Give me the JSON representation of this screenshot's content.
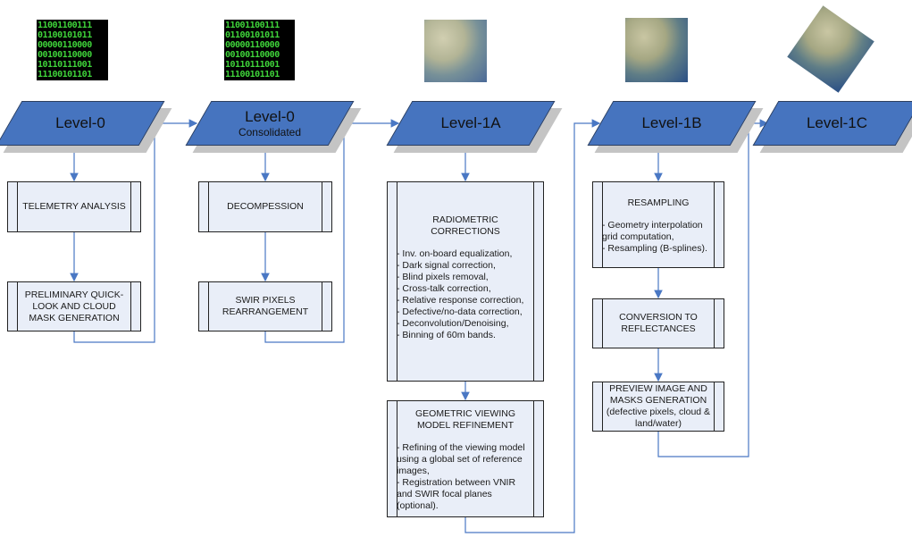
{
  "levels": [
    {
      "title": "Level-0",
      "subtitle": ""
    },
    {
      "title": "Level-0",
      "subtitle": "Consolidated"
    },
    {
      "title": "Level-1A",
      "subtitle": ""
    },
    {
      "title": "Level-1B",
      "subtitle": ""
    },
    {
      "title": "Level-1C",
      "subtitle": ""
    }
  ],
  "binary_rows": [
    "11001100111",
    "01100101011",
    "00000110000",
    "00100110000",
    "10110111001",
    "11100101101"
  ],
  "colors": {
    "level_fill": "#4674bf",
    "box_fill": "#e9eef8",
    "connector": "#4a78c4"
  },
  "boxes": {
    "telemetry": {
      "title": "TELEMETRY ANALYSIS"
    },
    "quicklook": {
      "title": "PRELIMINARY QUICK-LOOK AND CLOUD MASK GENERATION"
    },
    "decompression": {
      "title": "DECOMPESSION"
    },
    "swir": {
      "title": "SWIR PIXELS REARRANGEMENT"
    },
    "radiometric": {
      "title": "RADIOMETRIC CORRECTIONS",
      "items": [
        "- Inv. on-board equalization,",
        "- Dark signal correction,",
        "- Blind pixels removal,",
        "- Cross-talk correction,",
        "- Relative response correction,",
        "- Defective/no-data correction,",
        "- Deconvolution/Denoising,",
        "- Binning of 60m bands."
      ]
    },
    "geometric": {
      "title": "GEOMETRIC VIEWING MODEL REFINEMENT",
      "items": [
        "- Refining of the viewing model using a global set of reference images,",
        "- Registration between VNIR and SWIR focal planes (optional)."
      ]
    },
    "resampling": {
      "title": "RESAMPLING",
      "items": [
        "- Geometry interpolation grid computation,",
        "- Resampling (B-splines)."
      ]
    },
    "conversion": {
      "title": "CONVERSION TO REFLECTANCES"
    },
    "preview": {
      "title": "PREVIEW IMAGE AND MASKS GENERATION (defective pixels, cloud & land/water)"
    }
  }
}
